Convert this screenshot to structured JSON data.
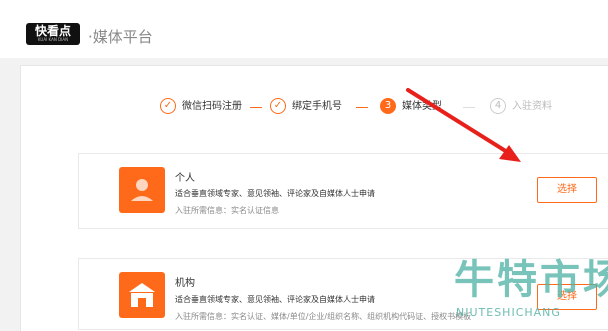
{
  "header": {
    "logo_text": "快看点",
    "logo_subtext": "KUAI KAN DIAN",
    "platform_title": "·媒体平台"
  },
  "steps": [
    {
      "marker": "✓",
      "label": "微信扫码注册",
      "state": "done"
    },
    {
      "marker": "✓",
      "label": "绑定手机号",
      "state": "done"
    },
    {
      "marker": "3",
      "label": "媒体类型",
      "state": "active"
    },
    {
      "marker": "4",
      "label": "入驻资料",
      "state": "todo"
    }
  ],
  "cards": [
    {
      "icon": "person-icon",
      "title": "个人",
      "description": "适合垂直领域专家、意见领袖、评论家及自媒体人士申请",
      "requirements": "入驻所需信息：实名认证信息",
      "button_label": "选择"
    },
    {
      "icon": "building-icon",
      "title": "机构",
      "description": "适合垂直领域专家、意见领袖、评论家及自媒体人士申请",
      "requirements": "入驻所需信息：实名认证、媒体/单位/企业/组织名称、组织机构代码证、授权书模板",
      "button_label": "选择"
    }
  ],
  "watermark": {
    "text": "牛特市场",
    "subtext": "NIUTESHICHANG"
  },
  "colors": {
    "accent": "#ff6a1a",
    "annotation_arrow": "#e8201c",
    "watermark": "#52b2a6"
  }
}
